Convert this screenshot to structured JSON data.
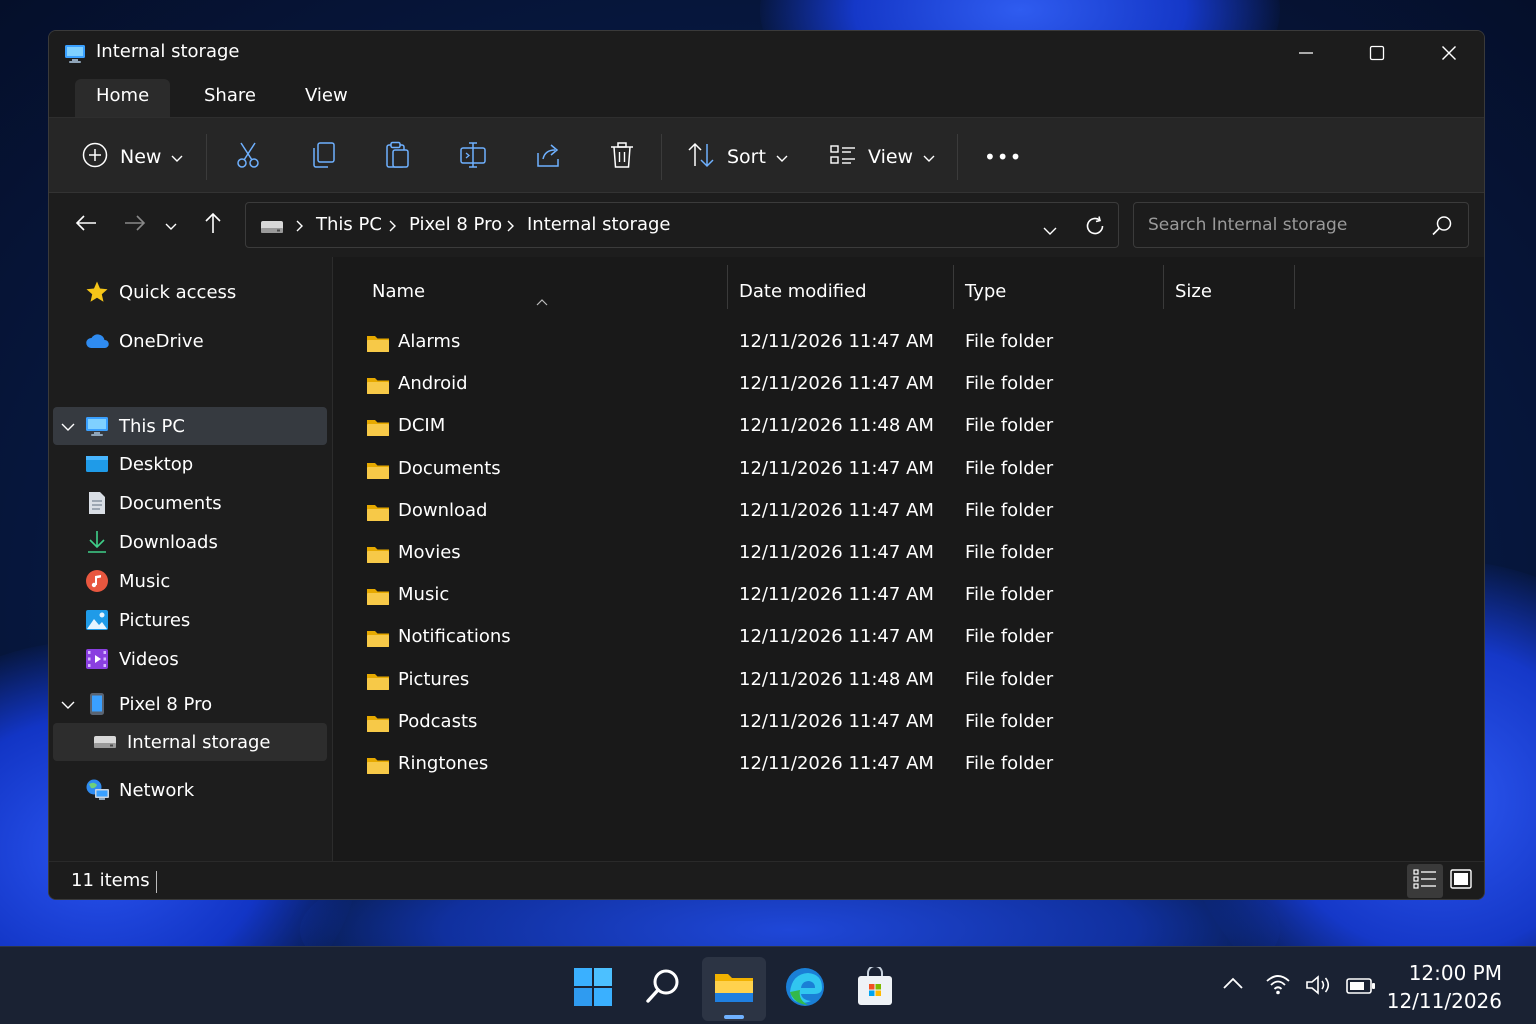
{
  "window": {
    "title": "Internal storage",
    "ribbon_tabs": [
      "Home",
      "Share",
      "View"
    ],
    "toolbar": {
      "new_label": "New",
      "sort_label": "Sort",
      "view_label": "View",
      "more_label": "•••"
    }
  },
  "address": {
    "crumbs": [
      "This PC",
      "Pixel 8 Pro",
      "Internal storage"
    ],
    "search_placeholder": "Search Internal storage"
  },
  "sidebar": {
    "items": [
      {
        "label": "Quick access",
        "icon": "star-icon"
      },
      {
        "label": "OneDrive",
        "icon": "cloud-icon"
      },
      {
        "label": "This PC",
        "icon": "monitor-icon",
        "expanded": true,
        "selected": true
      },
      {
        "label": "Desktop",
        "icon": "desktop-icon"
      },
      {
        "label": "Documents",
        "icon": "document-icon"
      },
      {
        "label": "Downloads",
        "icon": "download-icon"
      },
      {
        "label": "Music",
        "icon": "music-icon"
      },
      {
        "label": "Pictures",
        "icon": "picture-icon"
      },
      {
        "label": "Videos",
        "icon": "video-icon"
      },
      {
        "label": "Pixel 8 Pro",
        "icon": "phone-icon",
        "expanded": true
      },
      {
        "label": "Internal storage",
        "icon": "drive-icon",
        "current": true
      },
      {
        "label": "Network",
        "icon": "network-icon"
      }
    ]
  },
  "files": {
    "columns": [
      "Name",
      "Date modified",
      "Type",
      "Size"
    ],
    "rows": [
      {
        "name": "Alarms",
        "date": "12/11/2026 11:47 AM",
        "type": "File folder"
      },
      {
        "name": "Android",
        "date": "12/11/2026 11:47 AM",
        "type": "File folder"
      },
      {
        "name": "DCIM",
        "date": "12/11/2026 11:48 AM",
        "type": "File folder"
      },
      {
        "name": "Documents",
        "date": "12/11/2026 11:47 AM",
        "type": "File folder"
      },
      {
        "name": "Download",
        "date": "12/11/2026 11:47 AM",
        "type": "File folder"
      },
      {
        "name": "Movies",
        "date": "12/11/2026 11:47 AM",
        "type": "File folder"
      },
      {
        "name": "Music",
        "date": "12/11/2026 11:47 AM",
        "type": "File folder"
      },
      {
        "name": "Notifications",
        "date": "12/11/2026 11:47 AM",
        "type": "File folder"
      },
      {
        "name": "Pictures",
        "date": "12/11/2026 11:48 AM",
        "type": "File folder"
      },
      {
        "name": "Podcasts",
        "date": "12/11/2026 11:47 AM",
        "type": "File folder"
      },
      {
        "name": "Ringtones",
        "date": "12/11/2026 11:47 AM",
        "type": "File folder"
      }
    ]
  },
  "status": {
    "count": "11 items"
  },
  "taskbar": {
    "apps": [
      "start-icon",
      "search-icon",
      "file-explorer-icon",
      "edge-icon",
      "store-icon"
    ],
    "time": "12:00 PM",
    "date": "12/11/2026"
  },
  "colors": {
    "accent": "#60cdff",
    "folder": "#f7c948",
    "window_bg": "#191919"
  }
}
